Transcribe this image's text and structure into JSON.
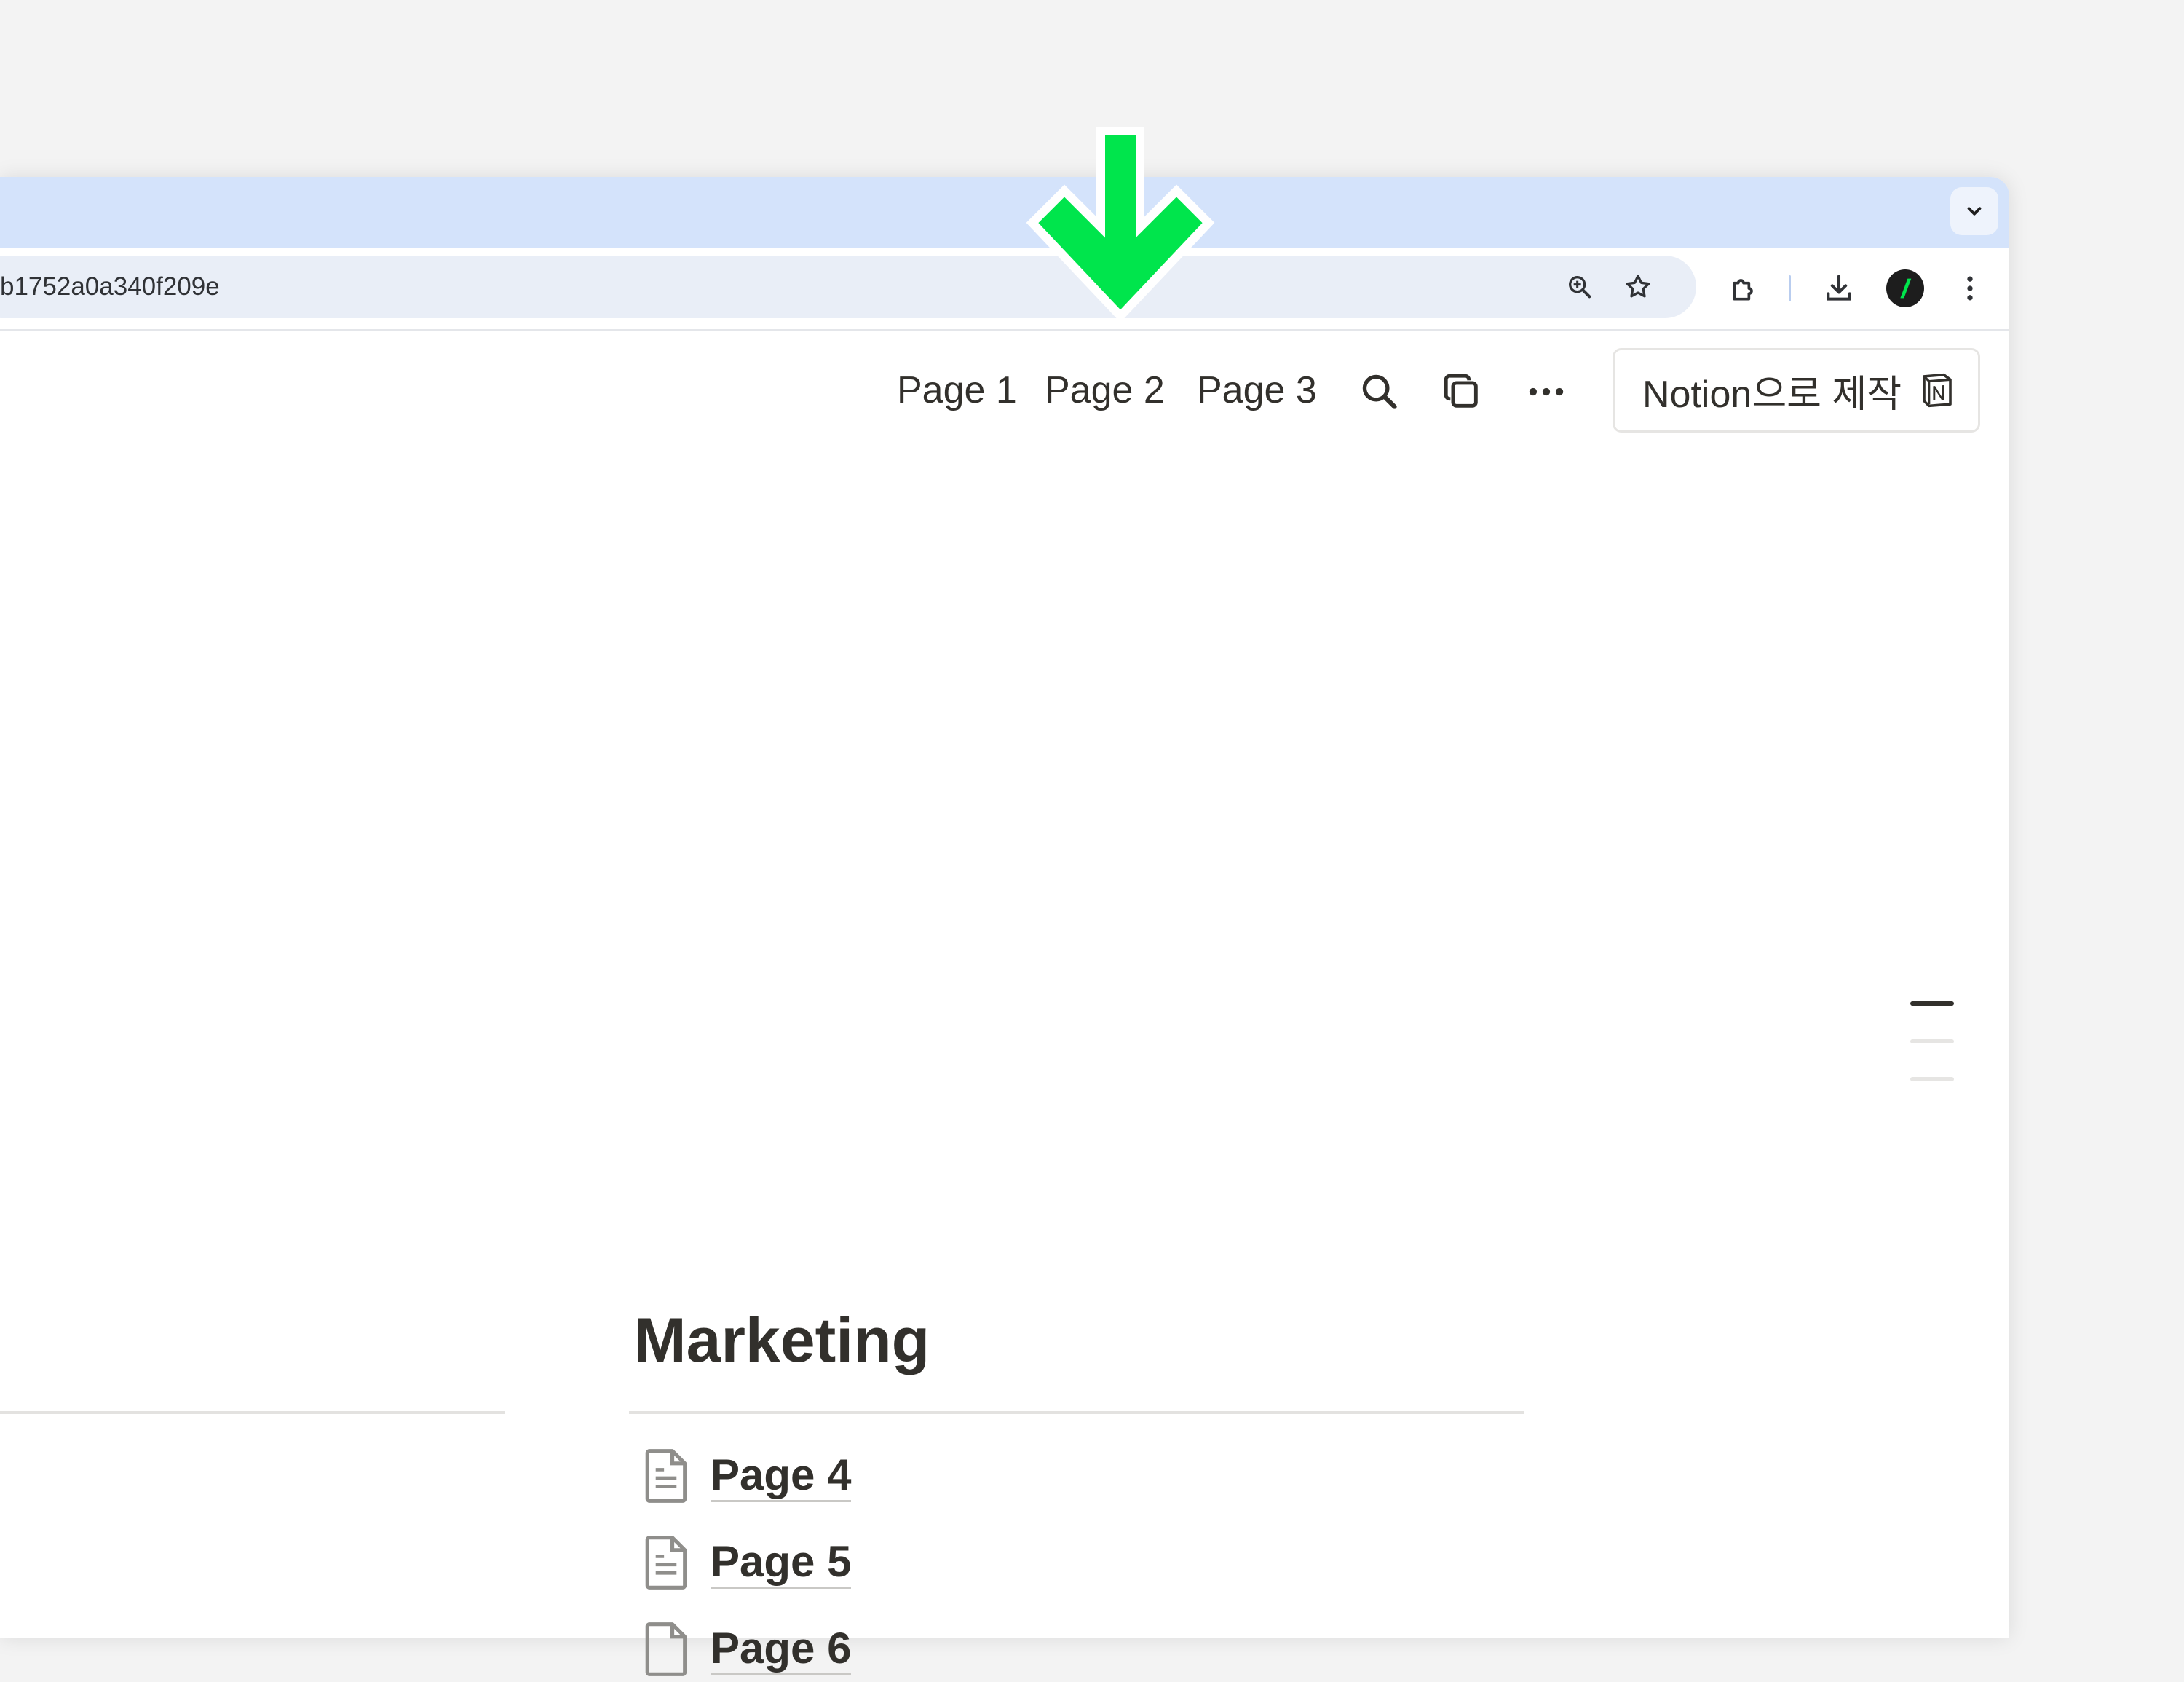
{
  "browser": {
    "url": "b1752a0a340f209e",
    "icons": [
      "chevron-down-icon",
      "zoom-icon",
      "star-icon",
      "extensions-icon",
      "download-icon",
      "profile-avatar",
      "more-vert-icon"
    ]
  },
  "notion": {
    "nav_links": [
      "Page 1",
      "Page 2",
      "Page 3"
    ],
    "nav_icons": [
      "search-icon",
      "duplicate-icon",
      "more-horizontal-icon"
    ],
    "made_with_button": "Notion으로 제작",
    "section_title": "Marketing",
    "pages": [
      "Page 4",
      "Page 5",
      "Page 6"
    ]
  },
  "annotation": {
    "arrow_color": "#00e54c",
    "points_to": "Page 2"
  },
  "colors": {
    "tabstrip": "#d4e3fb",
    "omnibox": "#e9eef7",
    "text": "#32302c",
    "accent_green": "#00e54c"
  }
}
